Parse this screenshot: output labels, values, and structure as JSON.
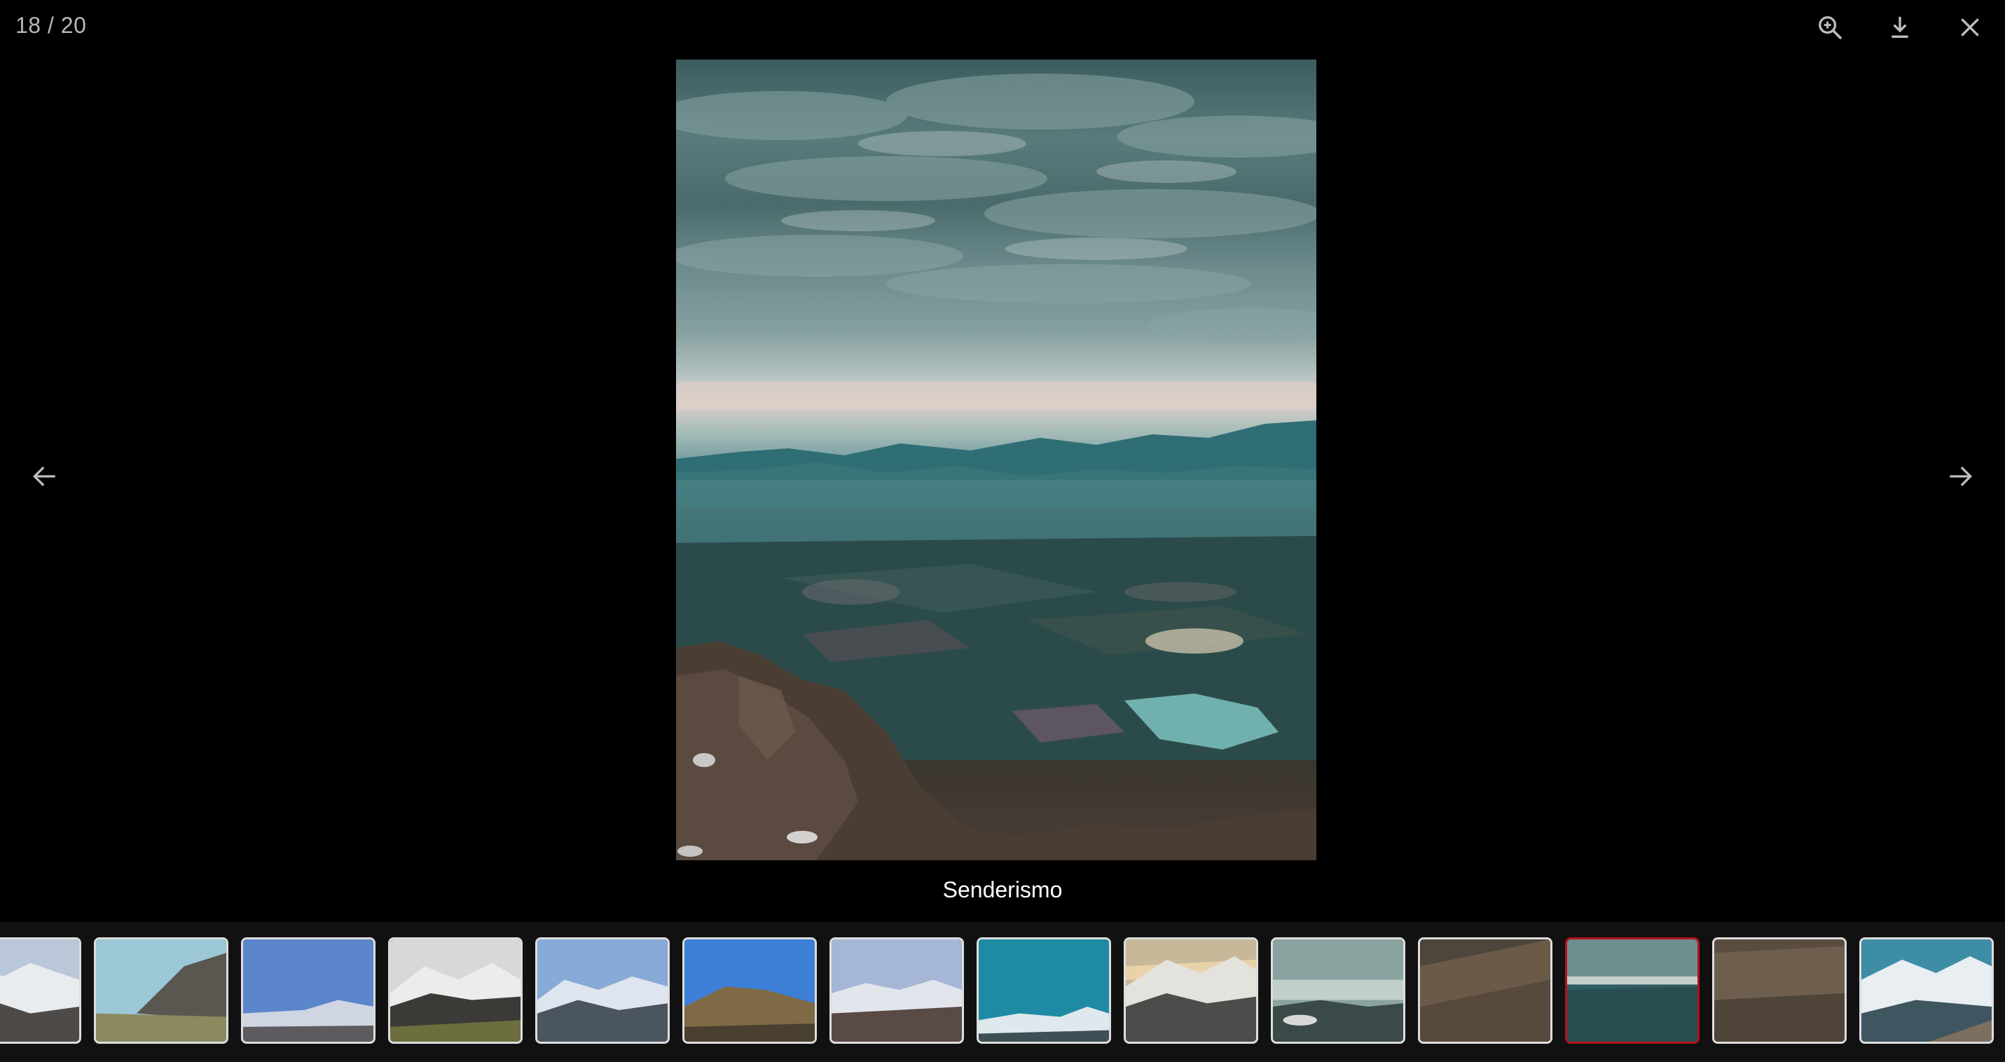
{
  "viewer": {
    "counter": "18 / 20",
    "caption": "Senderismo",
    "current_index": 18,
    "total": 20
  },
  "toolbar": {
    "zoom_icon": "zoom-in-icon",
    "download_icon": "download-icon",
    "close_icon": "close-icon"
  },
  "navigation": {
    "prev_icon": "arrow-left-icon",
    "next_icon": "arrow-right-icon"
  },
  "colors": {
    "background": "#000000",
    "counter_text": "#b8b8b8",
    "active_thumb_border": "#b3121c",
    "thumb_border": "#dddddd"
  },
  "thumbnails": [
    {
      "scene": "snowy-ridge"
    },
    {
      "scene": "green-valley-cliff"
    },
    {
      "scene": "blue-sky-snow"
    },
    {
      "scene": "snowy-peaks-dark"
    },
    {
      "scene": "rocky-range"
    },
    {
      "scene": "golden-hill"
    },
    {
      "scene": "snow-valley"
    },
    {
      "scene": "teal-mountain"
    },
    {
      "scene": "sunset-peaks"
    },
    {
      "scene": "misty-lake"
    },
    {
      "scene": "brown-slope"
    },
    {
      "scene": "cloudy-valley",
      "active": true
    },
    {
      "scene": "rocky-brush"
    },
    {
      "scene": "snowy-teal-range"
    }
  ]
}
